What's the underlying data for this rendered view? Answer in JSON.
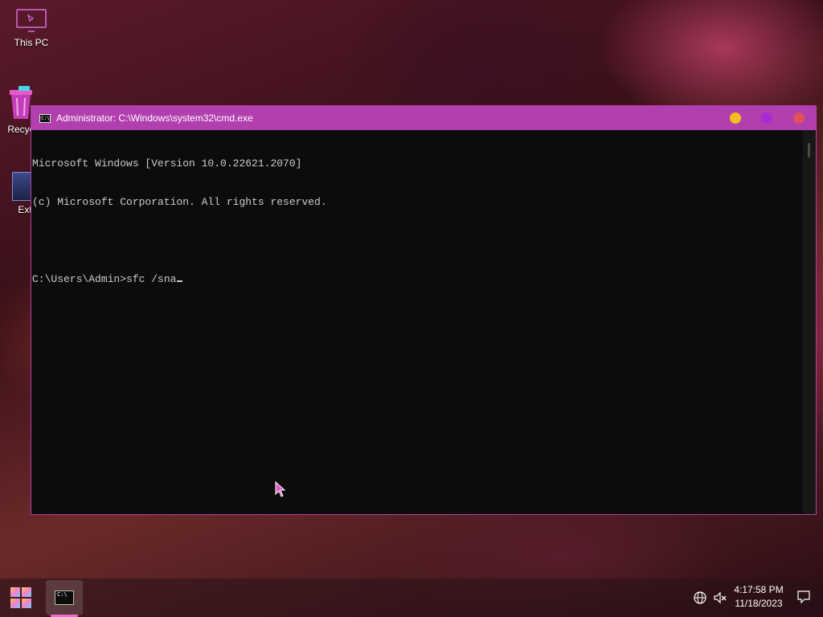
{
  "desktop": {
    "icons": [
      {
        "label": "This PC",
        "icon": "monitor-icon"
      },
      {
        "label": "Recyc",
        "icon": "recycle-bin-icon"
      },
      {
        "label": "Ext",
        "icon": "app-shortcut-icon"
      }
    ]
  },
  "window": {
    "title": "Administrator: C:\\Windows\\system32\\cmd.exe",
    "title_icon_text": "C:\\",
    "colors": {
      "titlebar": "#b23fae",
      "minimize": "#f2bd1e",
      "maximize": "#a72bd3",
      "close": "#e04f5b"
    }
  },
  "console": {
    "lines": [
      "Microsoft Windows [Version 10.0.22621.2070]",
      "(c) Microsoft Corporation. All rights reserved.",
      "",
      "C:\\Users\\Admin>sfc /sna"
    ]
  },
  "taskbar": {
    "start_icon": "windows-logo-icon",
    "apps": [
      {
        "name": "Command Prompt",
        "icon": "terminal-icon",
        "icon_text": "C:\\"
      }
    ],
    "tray": {
      "icons": [
        "globe-icon",
        "volume-muted-icon"
      ],
      "time": "4:17:58 PM",
      "date": "11/18/2023",
      "notification_icon": "notification-icon"
    }
  }
}
